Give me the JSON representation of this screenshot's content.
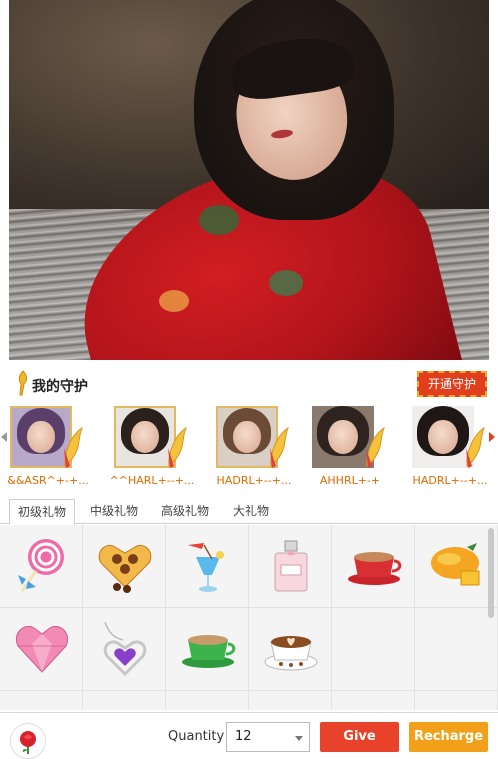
{
  "guard": {
    "title": "我的守护",
    "open_button": "开通守护",
    "members": [
      {
        "name": "&&ASR^+-+...",
        "framed": true
      },
      {
        "name": "^^HARL+--+...",
        "framed": true
      },
      {
        "name": "HADRL+--+...",
        "framed": true
      },
      {
        "name": "AHHRL+-+",
        "framed": false
      },
      {
        "name": "HADRL+--+...",
        "framed": false
      }
    ]
  },
  "gift_tabs": [
    {
      "label": "初级礼物",
      "active": true
    },
    {
      "label": "中级礼物",
      "active": false
    },
    {
      "label": "高级礼物",
      "active": false
    },
    {
      "label": "大礼物",
      "active": false
    }
  ],
  "gifts": [
    {
      "icon": "lollipop-icon"
    },
    {
      "icon": "chocolate-box-icon"
    },
    {
      "icon": "cocktail-icon"
    },
    {
      "icon": "perfume-icon"
    },
    {
      "icon": "coffee-cup-icon"
    },
    {
      "icon": "mango-icon"
    },
    {
      "icon": "pink-diamond-heart-icon"
    },
    {
      "icon": "heart-pendant-icon"
    },
    {
      "icon": "green-coffee-cup-icon"
    },
    {
      "icon": "latte-art-icon"
    },
    {
      "icon": "empty"
    },
    {
      "icon": "empty"
    }
  ],
  "bottom": {
    "quantity_label": "Quantity",
    "quantity_value": "12",
    "give_label": "Give",
    "recharge_label": "Recharge"
  },
  "colors": {
    "accent_red": "#e8432a",
    "accent_orange": "#f2a019",
    "guard_name": "#e06a00"
  }
}
